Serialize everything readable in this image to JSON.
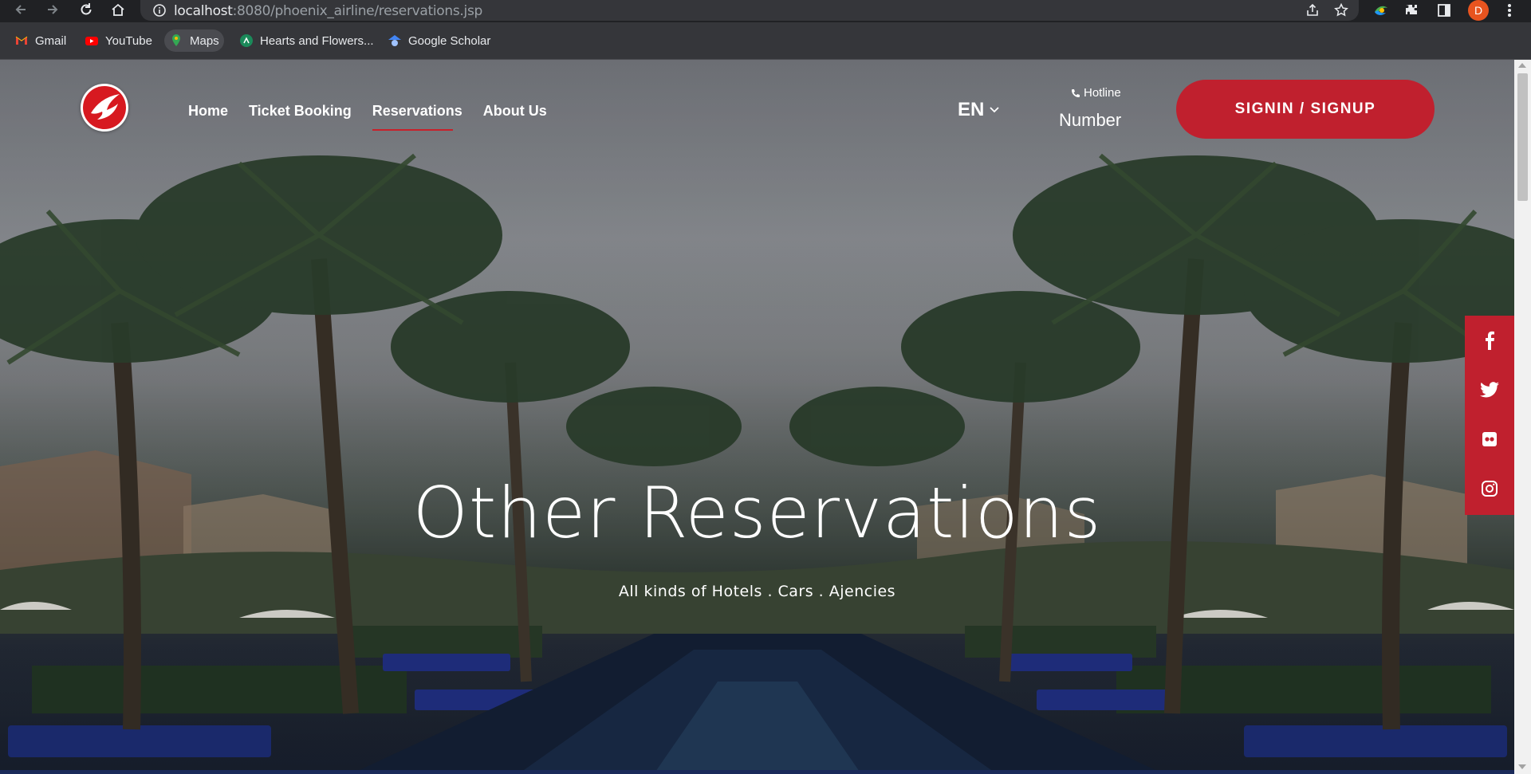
{
  "browser": {
    "url_host": "localhost",
    "url_rest": ":8080/phoenix_airline/reservations.jsp",
    "profile_initial": "D"
  },
  "bookmarks": [
    {
      "label": "Gmail",
      "icon": "gmail-icon"
    },
    {
      "label": "YouTube",
      "icon": "youtube-icon"
    },
    {
      "label": "Maps",
      "icon": "maps-icon"
    },
    {
      "label": "Hearts and Flowers...",
      "icon": "hearts-flowers-icon"
    },
    {
      "label": "Google Scholar",
      "icon": "google-scholar-icon"
    }
  ],
  "nav": {
    "items": [
      {
        "label": "Home"
      },
      {
        "label": "Ticket Booking"
      },
      {
        "label": "Reservations",
        "active": true
      },
      {
        "label": "About Us"
      }
    ],
    "lang": "EN",
    "hotline_label": "Hotline",
    "hotline_number": "Number",
    "signin_label": "SIGNIN / SIGNUP"
  },
  "hero": {
    "title": "Other Reservations",
    "subtitle": "All kinds of Hotels . Cars . Ajencies"
  },
  "social": [
    "facebook-icon",
    "twitter-icon",
    "flickr-icon",
    "instagram-icon"
  ],
  "colors": {
    "accent": "#c0202e",
    "chrome_bg": "#202124",
    "bookmark_bar": "#35363a"
  }
}
